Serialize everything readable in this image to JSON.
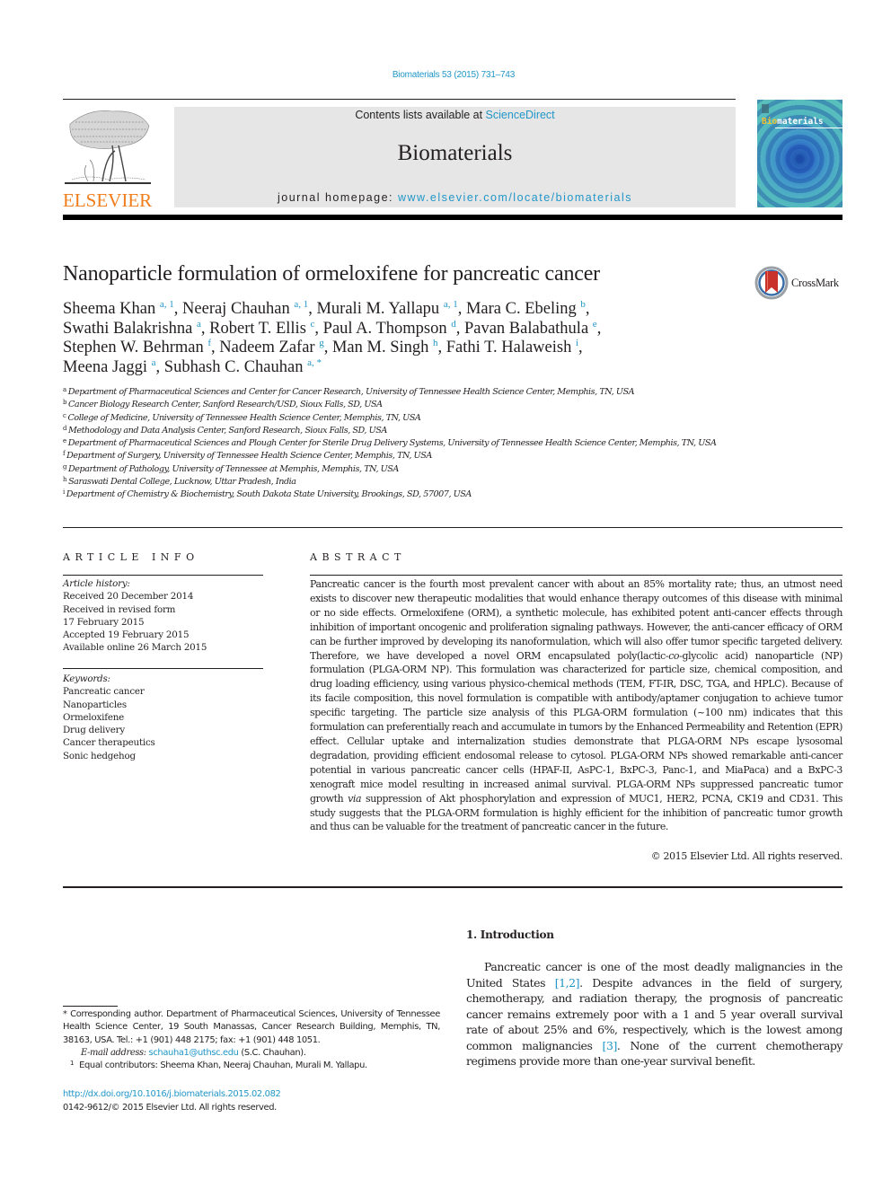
{
  "header": {
    "journal_ref": "Biomaterials 53 (2015) 731–743",
    "contents_prefix": "Contents lists available at ",
    "contents_link": "ScienceDirect",
    "journal_name": "Biomaterials",
    "homepage_prefix": "journal homepage: ",
    "homepage_link": "www.elsevier.com/locate/biomaterials",
    "publisher_logo_text": "ELSEVIER",
    "cover_title_highlight": "Bio",
    "cover_title_rest": "materials",
    "crossmark_label": "CrossMark"
  },
  "article": {
    "title": "Nanoparticle formulation of ormeloxifene for pancreatic cancer",
    "authors": [
      {
        "name": "Sheema Khan",
        "aff": "a, 1",
        "sep": ", "
      },
      {
        "name": "Neeraj Chauhan",
        "aff": "a, 1",
        "sep": ", "
      },
      {
        "name": "Murali M. Yallapu",
        "aff": "a, 1",
        "sep": ", "
      },
      {
        "name": "Mara C. Ebeling",
        "aff": "b",
        "sep": ","
      },
      {
        "name": "Swathi Balakrishna",
        "aff": "a",
        "sep": ", "
      },
      {
        "name": "Robert T. Ellis",
        "aff": "c",
        "sep": ", "
      },
      {
        "name": "Paul A. Thompson",
        "aff": "d",
        "sep": ", "
      },
      {
        "name": "Pavan Balabathula",
        "aff": "e",
        "sep": ","
      },
      {
        "name": "Stephen W. Behrman",
        "aff": "f",
        "sep": ", "
      },
      {
        "name": "Nadeem Zafar",
        "aff": "g",
        "sep": ", "
      },
      {
        "name": "Man M. Singh",
        "aff": "h",
        "sep": ", "
      },
      {
        "name": "Fathi T. Halaweish",
        "aff": "i",
        "sep": ","
      },
      {
        "name": "Meena Jaggi",
        "aff": "a",
        "sep": ", "
      },
      {
        "name": "Subhash C. Chauhan",
        "aff": "a, *",
        "sep": ""
      }
    ],
    "affiliations": [
      {
        "key": "a",
        "text": "Department of Pharmaceutical Sciences and Center for Cancer Research, University of Tennessee Health Science Center, Memphis, TN, USA"
      },
      {
        "key": "b",
        "text": "Cancer Biology Research Center, Sanford Research/USD, Sioux Falls, SD, USA"
      },
      {
        "key": "c",
        "text": "College of Medicine, University of Tennessee Health Science Center, Memphis, TN, USA"
      },
      {
        "key": "d",
        "text": "Methodology and Data Analysis Center, Sanford Research, Sioux Falls, SD, USA"
      },
      {
        "key": "e",
        "text": "Department of Pharmaceutical Sciences and Plough Center for Sterile Drug Delivery Systems, University of Tennessee Health Science Center, Memphis, TN, USA"
      },
      {
        "key": "f",
        "text": "Department of Surgery, University of Tennessee Health Science Center, Memphis, TN, USA"
      },
      {
        "key": "g",
        "text": "Department of Pathology, University of Tennessee at Memphis, Memphis, TN, USA"
      },
      {
        "key": "h",
        "text": "Saraswati Dental College, Lucknow, Uttar Pradesh, India"
      },
      {
        "key": "i",
        "text": "Department of Chemistry & Biochemistry, South Dakota State University, Brookings, SD, 57007, USA"
      }
    ]
  },
  "article_info": {
    "heading": "ARTICLE INFO",
    "history_label": "Article history:",
    "history": [
      "Received 20 December 2014",
      "Received in revised form",
      "17 February 2015",
      "Accepted 19 February 2015",
      "Available online 26 March 2015"
    ],
    "keywords_label": "Keywords:",
    "keywords": [
      "Pancreatic cancer",
      "Nanoparticles",
      "Ormeloxifene",
      "Drug delivery",
      "Cancer therapeutics",
      "Sonic hedgehog"
    ]
  },
  "abstract": {
    "heading": "ABSTRACT",
    "part1": "Pancreatic cancer is the fourth most prevalent cancer with about an 85% mortality rate; thus, an utmost need exists to discover new therapeutic modalities that would enhance therapy outcomes of this disease with minimal or no side effects. Ormeloxifene (ORM), a synthetic molecule, has exhibited potent anti-cancer effects through inhibition of important oncogenic and proliferation signaling pathways. However, the anti-cancer efficacy of ORM can be further improved by developing its nanoformulation, which will also offer tumor specific targeted delivery. Therefore, we have developed a novel ORM encapsulated poly(lactic-",
    "italic1": "co",
    "part2": "-glycolic acid) nanoparticle (NP) formulation (PLGA-ORM NP). This formulation was characterized for particle size, chemical composition, and drug loading efficiency, using various physico-chemical methods (TEM, FT-IR, DSC, TGA, and HPLC). Because of its facile composition, this novel formulation is compatible with antibody/aptamer conjugation to achieve tumor specific targeting. The particle size analysis of this PLGA-ORM formulation (~100 nm) indicates that this formulation can preferentially reach and accumulate in tumors by the Enhanced Permeability and Retention (EPR) effect. Cellular uptake and internalization studies demonstrate that PLGA-ORM NPs escape lysosomal degradation, providing efficient endosomal release to cytosol. PLGA-ORM NPs showed remarkable anti-cancer potential in various pancreatic cancer cells (HPAF-II, AsPC-1, BxPC-3, Panc-1, and MiaPaca) and a BxPC-3 xenograft mice model resulting in increased animal survival. PLGA-ORM NPs suppressed pancreatic tumor growth ",
    "italic2": "via",
    "part3": " suppression of Akt phosphorylation and expression of MUC1, HER2, PCNA, CK19 and CD31. This study suggests that the PLGA-ORM formulation is highly efficient for the inhibition of pancreatic tumor growth and thus can be valuable for the treatment of pancreatic cancer in the future.",
    "copyright": "© 2015 Elsevier Ltd. All rights reserved."
  },
  "introduction": {
    "heading": "1.  Introduction",
    "t1": "Pancreatic cancer is one of the most deadly malignancies in the United States ",
    "ref1": "[1,2]",
    "t2": ". Despite advances in the field of surgery, chemotherapy, and radiation therapy, the prognosis of pancreatic cancer remains extremely poor with a 1 and 5 year overall survival rate of about 25% and 6%, respectively, which is the lowest among common malignancies ",
    "ref2": "[3]",
    "t3": ". None of the current chemotherapy regimens provide more than one-year survival benefit."
  },
  "footnotes": {
    "corresponding": "* Corresponding author. Department of Pharmaceutical Sciences, University of Tennessee Health Science Center, 19 South Manassas, Cancer Research Building, Memphis, TN, 38163, USA. Tel.: +1 (901) 448 2175; fax: +1 (901) 448 1051.",
    "email_label": "E-mail address:",
    "email": "schauha1@uthsc.edu",
    "email_suffix": " (S.C. Chauhan).",
    "equal_mark": "1",
    "equal": "Equal contributors: Sheema Khan, Neeraj Chauhan, Murali M. Yallapu.",
    "doi": "http://dx.doi.org/10.1016/j.biomaterials.2015.02.082",
    "issn": "0142-9612/© 2015 Elsevier Ltd. All rights reserved."
  },
  "colors": {
    "link": "#2196c8",
    "elsevier_orange": "#f07d1a",
    "header_gray": "#e6e6e6",
    "crossmark_red": "#c8322a"
  }
}
